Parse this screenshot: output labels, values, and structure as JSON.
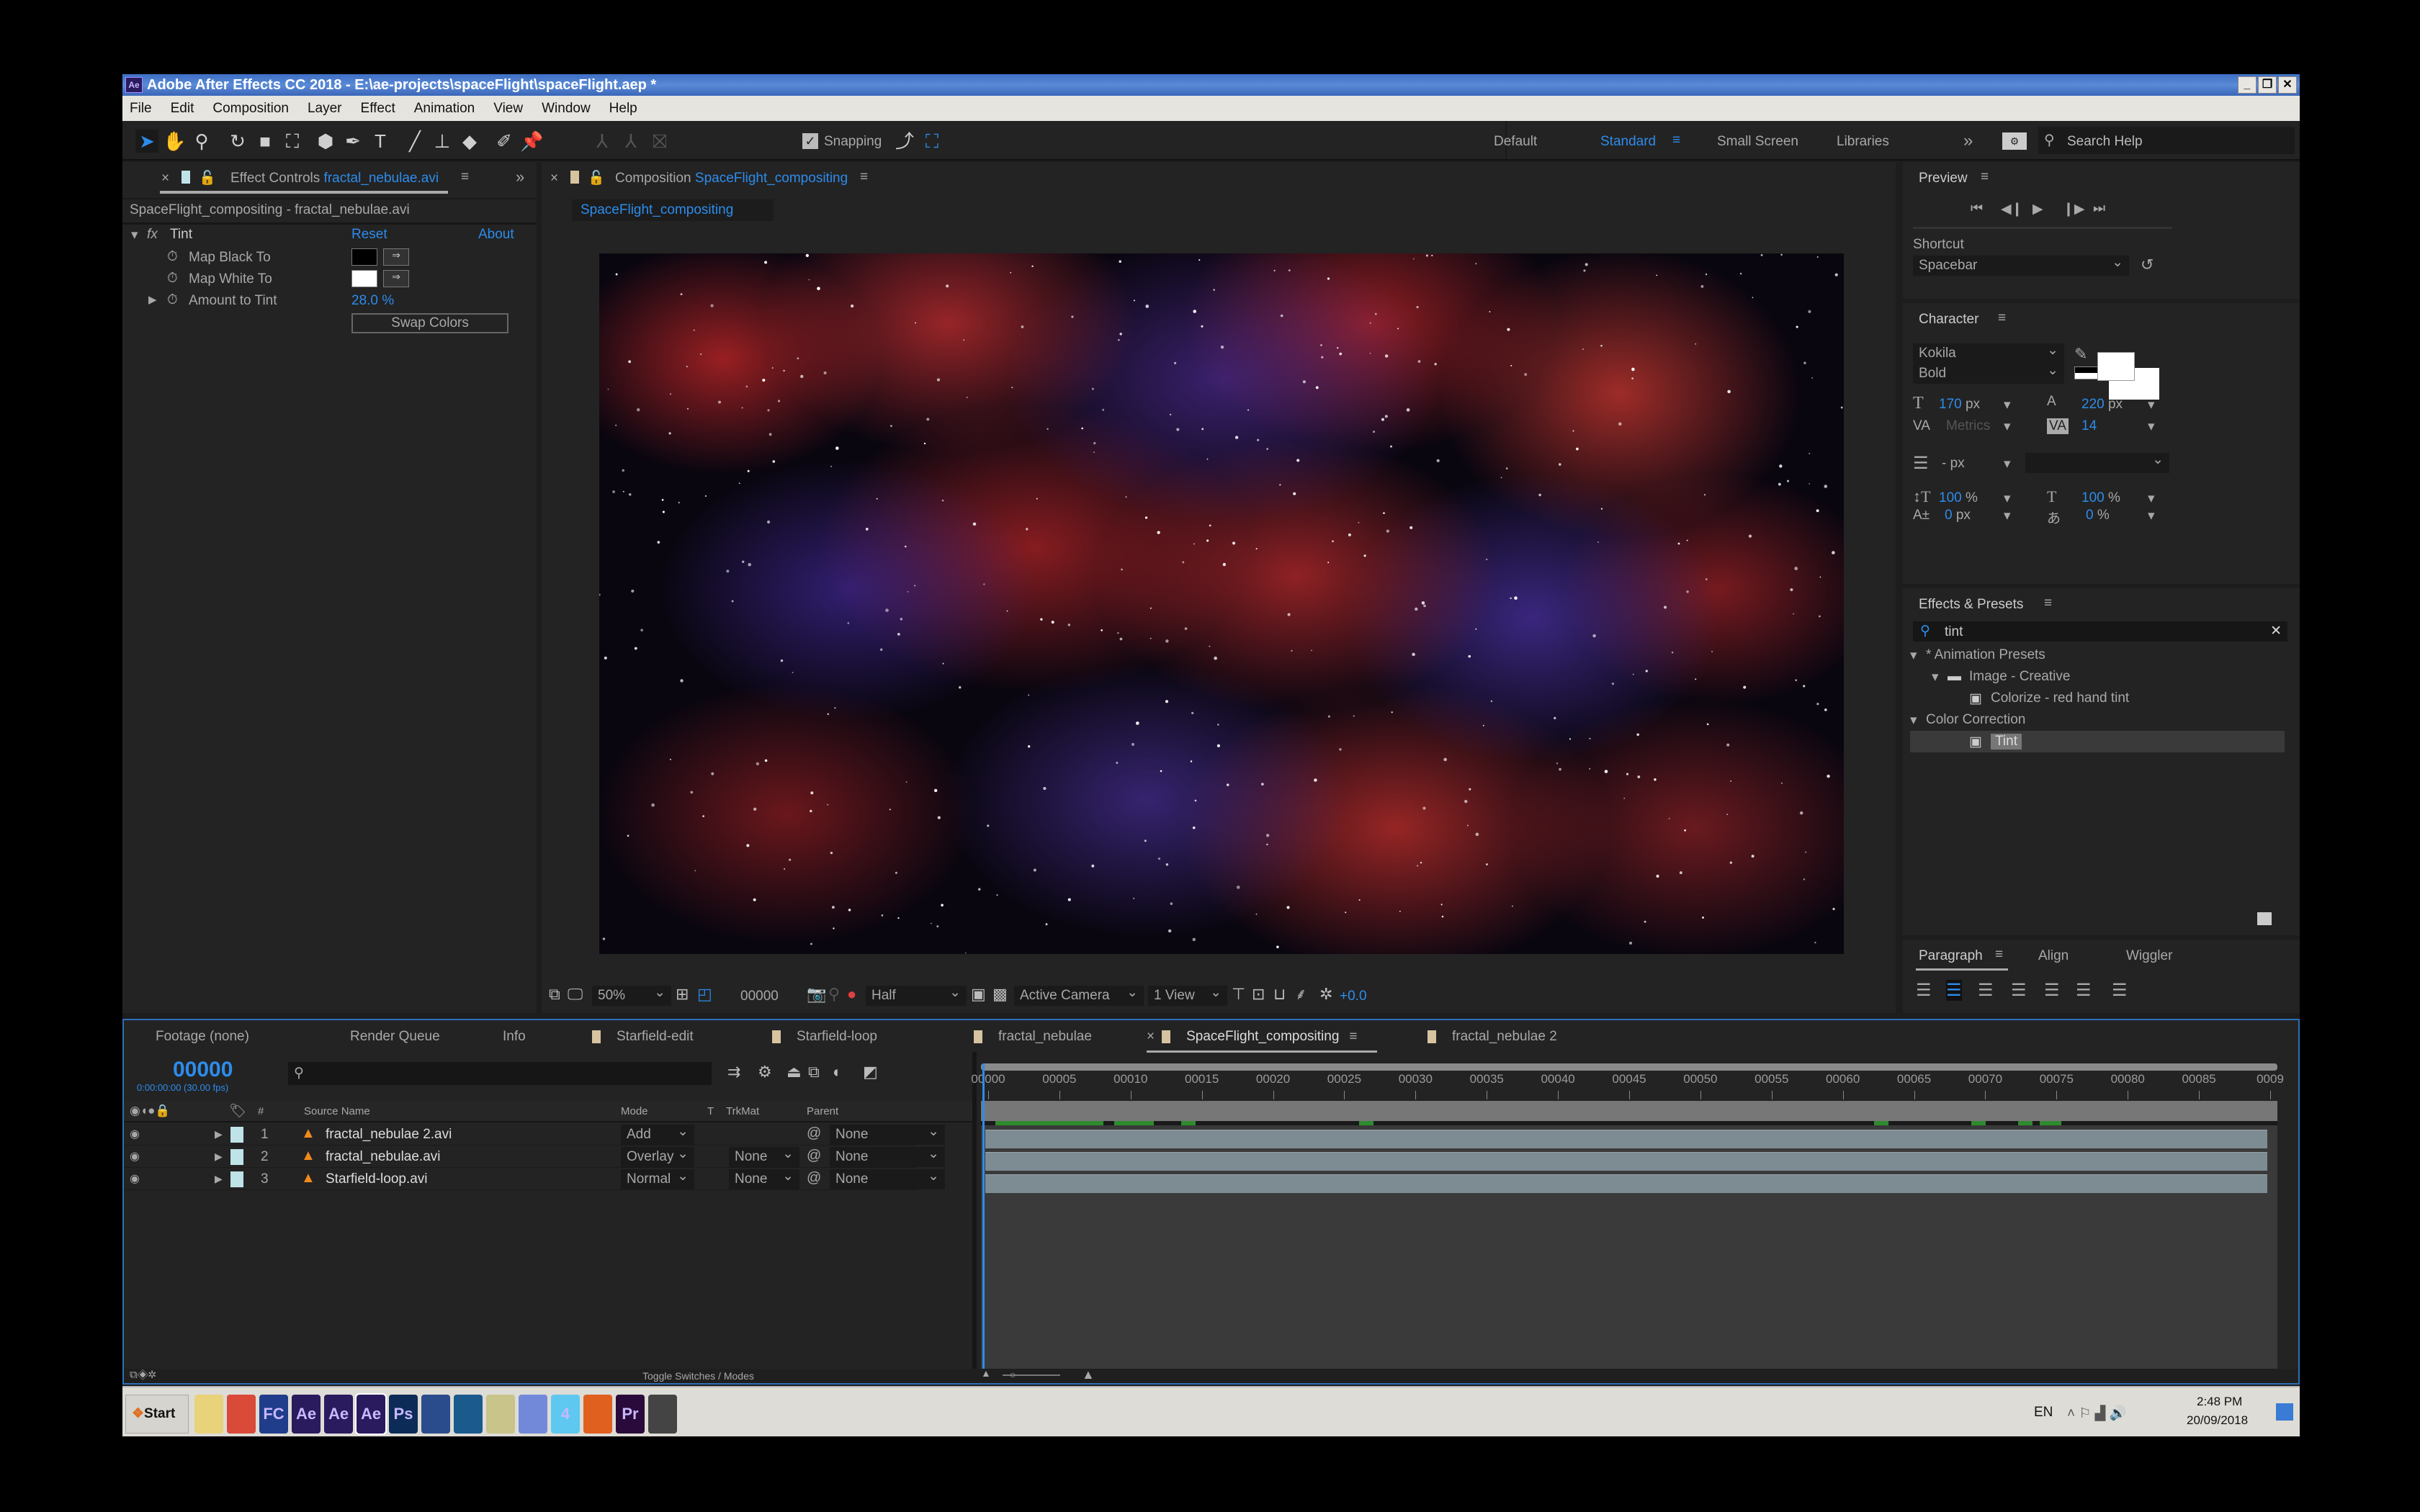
{
  "window": {
    "title": "Adobe After Effects CC 2018 - E:\\ae-projects\\spaceFlight\\spaceFlight.aep *",
    "app_icon": "Ae",
    "controls": [
      "_",
      "❐",
      "✕"
    ]
  },
  "menu": [
    "File",
    "Edit",
    "Composition",
    "Layer",
    "Effect",
    "Animation",
    "View",
    "Window",
    "Help"
  ],
  "toolbar": {
    "snapping_label": "Snapping",
    "snapping_checked": true,
    "workspaces": [
      {
        "label": "Default",
        "active": false
      },
      {
        "label": "Standard",
        "active": true
      },
      {
        "label": "Small Screen",
        "active": false
      },
      {
        "label": "Libraries",
        "active": false
      }
    ],
    "more": "»",
    "search_placeholder": "Search Help"
  },
  "effect_controls": {
    "tab_prefix": "Effect Controls",
    "tab_file": "fractal_nebulae.avi",
    "more": "»",
    "breadcrumb": "SpaceFlight_compositing - fractal_nebulae.avi",
    "effect_name": "Tint",
    "fx": "fx",
    "reset": "Reset",
    "about": "About",
    "props": [
      {
        "label": "Map Black To",
        "color": "#000000"
      },
      {
        "label": "Map White To",
        "color": "#ffffff"
      },
      {
        "label": "Amount to Tint",
        "value": "28.0 %"
      }
    ],
    "swap": "Swap Colors"
  },
  "composition": {
    "tab_prefix": "Composition",
    "tab_name": "SpaceFlight_compositing",
    "subtab": "SpaceFlight_compositing",
    "footer": {
      "zoom": "50%",
      "timecode": "00000",
      "resolution": "Half",
      "camera": "Active Camera",
      "views": "1 View",
      "exposure": "+0.0"
    }
  },
  "preview": {
    "title": "Preview",
    "shortcut_label": "Shortcut",
    "shortcut": "Spacebar"
  },
  "character": {
    "title": "Character",
    "font": "Kokila",
    "style": "Bold",
    "size": "170",
    "size_unit": "px",
    "leading": "220",
    "leading_unit": "px",
    "kerning": "Metrics",
    "tracking": "14",
    "stroke": "-",
    "stroke_unit": "px",
    "vscale": "100",
    "hscale": "100",
    "pct": "%",
    "baseline": "0",
    "baseline_unit": "px",
    "tsume": "0",
    "fill": "#ffffff",
    "stroke_color": "none"
  },
  "effects_presets": {
    "title": "Effects & Presets",
    "search": "tint",
    "tree": [
      {
        "label": "* Animation Presets",
        "level": 0,
        "expanded": true
      },
      {
        "label": "Image - Creative",
        "level": 1,
        "expanded": true
      },
      {
        "label": "Colorize - red hand tint",
        "level": 2
      },
      {
        "label": "Color Correction",
        "level": 0,
        "expanded": true
      },
      {
        "label": "Tint",
        "level": 2,
        "selected": true
      }
    ]
  },
  "paragraph": {
    "tabs": [
      "Paragraph",
      "Align",
      "Wiggler"
    ],
    "active_align": 1
  },
  "timeline": {
    "tabs": [
      {
        "label": "Footage (none)"
      },
      {
        "label": "Render Queue"
      },
      {
        "label": "Info"
      },
      {
        "label": "Starfield-edit",
        "comp": true
      },
      {
        "label": "Starfield-loop",
        "comp": true
      },
      {
        "label": "fractal_nebulae",
        "comp": true
      },
      {
        "label": "SpaceFlight_compositing",
        "comp": true,
        "active": true
      },
      {
        "label": "fractal_nebulae 2",
        "comp": true
      }
    ],
    "timecode": "00000",
    "timecode_sub": "0:00:00:00 (30.00 fps)",
    "columns": {
      "source": "Source Name",
      "mode": "Mode",
      "t": "T",
      "trkmat": "TrkMat",
      "parent": "Parent",
      "num": "#"
    },
    "layers": [
      {
        "num": "1",
        "name": "fractal_nebulae 2.avi",
        "mode": "Add",
        "trkmat": "",
        "parent": "None"
      },
      {
        "num": "2",
        "name": "fractal_nebulae.avi",
        "mode": "Overlay",
        "trkmat": "None",
        "parent": "None"
      },
      {
        "num": "3",
        "name": "Starfield-loop.avi",
        "mode": "Normal",
        "trkmat": "None",
        "parent": "None"
      }
    ],
    "ruler": [
      "00000",
      "00005",
      "00010",
      "00015",
      "00020",
      "00025",
      "00030",
      "00035",
      "00040",
      "00045",
      "00050",
      "00055",
      "00060",
      "00065",
      "00070",
      "00075",
      "00080",
      "00085",
      "0009"
    ],
    "toggle": "Toggle Switches / Modes"
  },
  "taskbar": {
    "start": "Start",
    "apps": [
      {
        "label": "",
        "name": "explorer",
        "bg": "#e8d27a"
      },
      {
        "label": "",
        "name": "chrome",
        "bg": "#d94a38"
      },
      {
        "label": "FC",
        "name": "fc",
        "bg": "#1f3d8a"
      },
      {
        "label": "Ae",
        "name": "after-effects-1",
        "bg": "#2a1a5e"
      },
      {
        "label": "Ae",
        "name": "after-effects-2",
        "bg": "#2a1a5e"
      },
      {
        "label": "Ae",
        "name": "after-effects-3",
        "bg": "#2a1a5e"
      },
      {
        "label": "Ps",
        "name": "photoshop",
        "bg": "#0d2b57"
      },
      {
        "label": "",
        "name": "cinema4d",
        "bg": "#2b4c8c"
      },
      {
        "label": "",
        "name": "sync",
        "bg": "#1a5a8c"
      },
      {
        "label": "",
        "name": "notes",
        "bg": "#c8c48a"
      },
      {
        "label": "",
        "name": "discord",
        "bg": "#7289da"
      },
      {
        "label": "4",
        "name": "app-4",
        "bg": "#5ec8f0"
      },
      {
        "label": "",
        "name": "star-app",
        "bg": "#e06020"
      },
      {
        "label": "Pr",
        "name": "premiere",
        "bg": "#2a0a3a"
      },
      {
        "label": "",
        "name": "tool",
        "bg": "#444"
      }
    ],
    "lang": "EN",
    "time": "2:48 PM",
    "date": "20/09/2018"
  }
}
